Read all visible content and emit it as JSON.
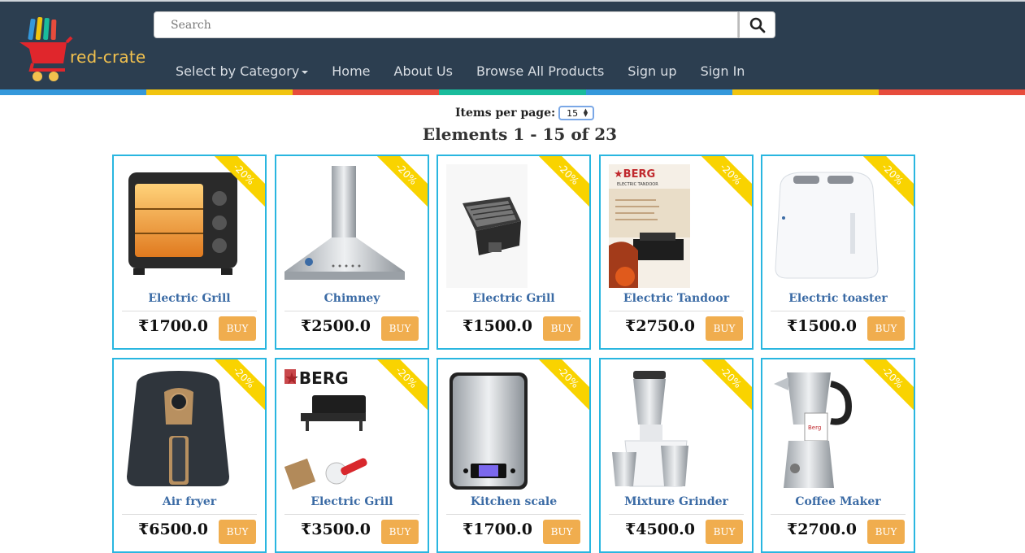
{
  "brand": {
    "name": "red-crate"
  },
  "search": {
    "placeholder": "Search"
  },
  "nav": [
    "Select by Category",
    "Home",
    "About Us",
    "Browse All Products",
    "Sign up",
    "Sign In"
  ],
  "pagination": {
    "items_per_page_label": "Items per page:",
    "items_per_page_value": "15",
    "elements_text": "Elements 1 - 15 of 23"
  },
  "discount_label": "-20%",
  "buy_label": "BUY",
  "products": [
    {
      "name": "Electric Grill",
      "price": "₹1700.0",
      "icon": "oven-toaster-image"
    },
    {
      "name": "Chimney",
      "price": "₹2500.0",
      "icon": "chimney-image"
    },
    {
      "name": "Electric Grill",
      "price": "₹1500.0",
      "icon": "electric-grill-image"
    },
    {
      "name": "Electric Tandoor",
      "price": "₹2750.0",
      "icon": "tandoor-brochure-image"
    },
    {
      "name": "Electric toaster",
      "price": "₹1500.0",
      "icon": "toaster-image"
    },
    {
      "name": "Air fryer",
      "price": "₹6500.0",
      "icon": "air-fryer-image"
    },
    {
      "name": "Electric Grill",
      "price": "₹3500.0",
      "icon": "berg-grill-image"
    },
    {
      "name": "Kitchen scale",
      "price": "₹1700.0",
      "icon": "kitchen-scale-image"
    },
    {
      "name": "Mixture Grinder",
      "price": "₹4500.0",
      "icon": "mixer-grinder-image"
    },
    {
      "name": "Coffee Maker",
      "price": "₹2700.0",
      "icon": "coffee-maker-image"
    }
  ],
  "colors": {
    "navbar": "#2c3e50",
    "card_border": "#29b6e0",
    "ribbon": "#f9d300",
    "buy_button": "#f0ad4e",
    "product_name": "#3b6ba5",
    "stripe": [
      "#3498db",
      "#f1c40f",
      "#e74c3c",
      "#1abc9c",
      "#3498db",
      "#f1c40f",
      "#e74c3c"
    ]
  }
}
